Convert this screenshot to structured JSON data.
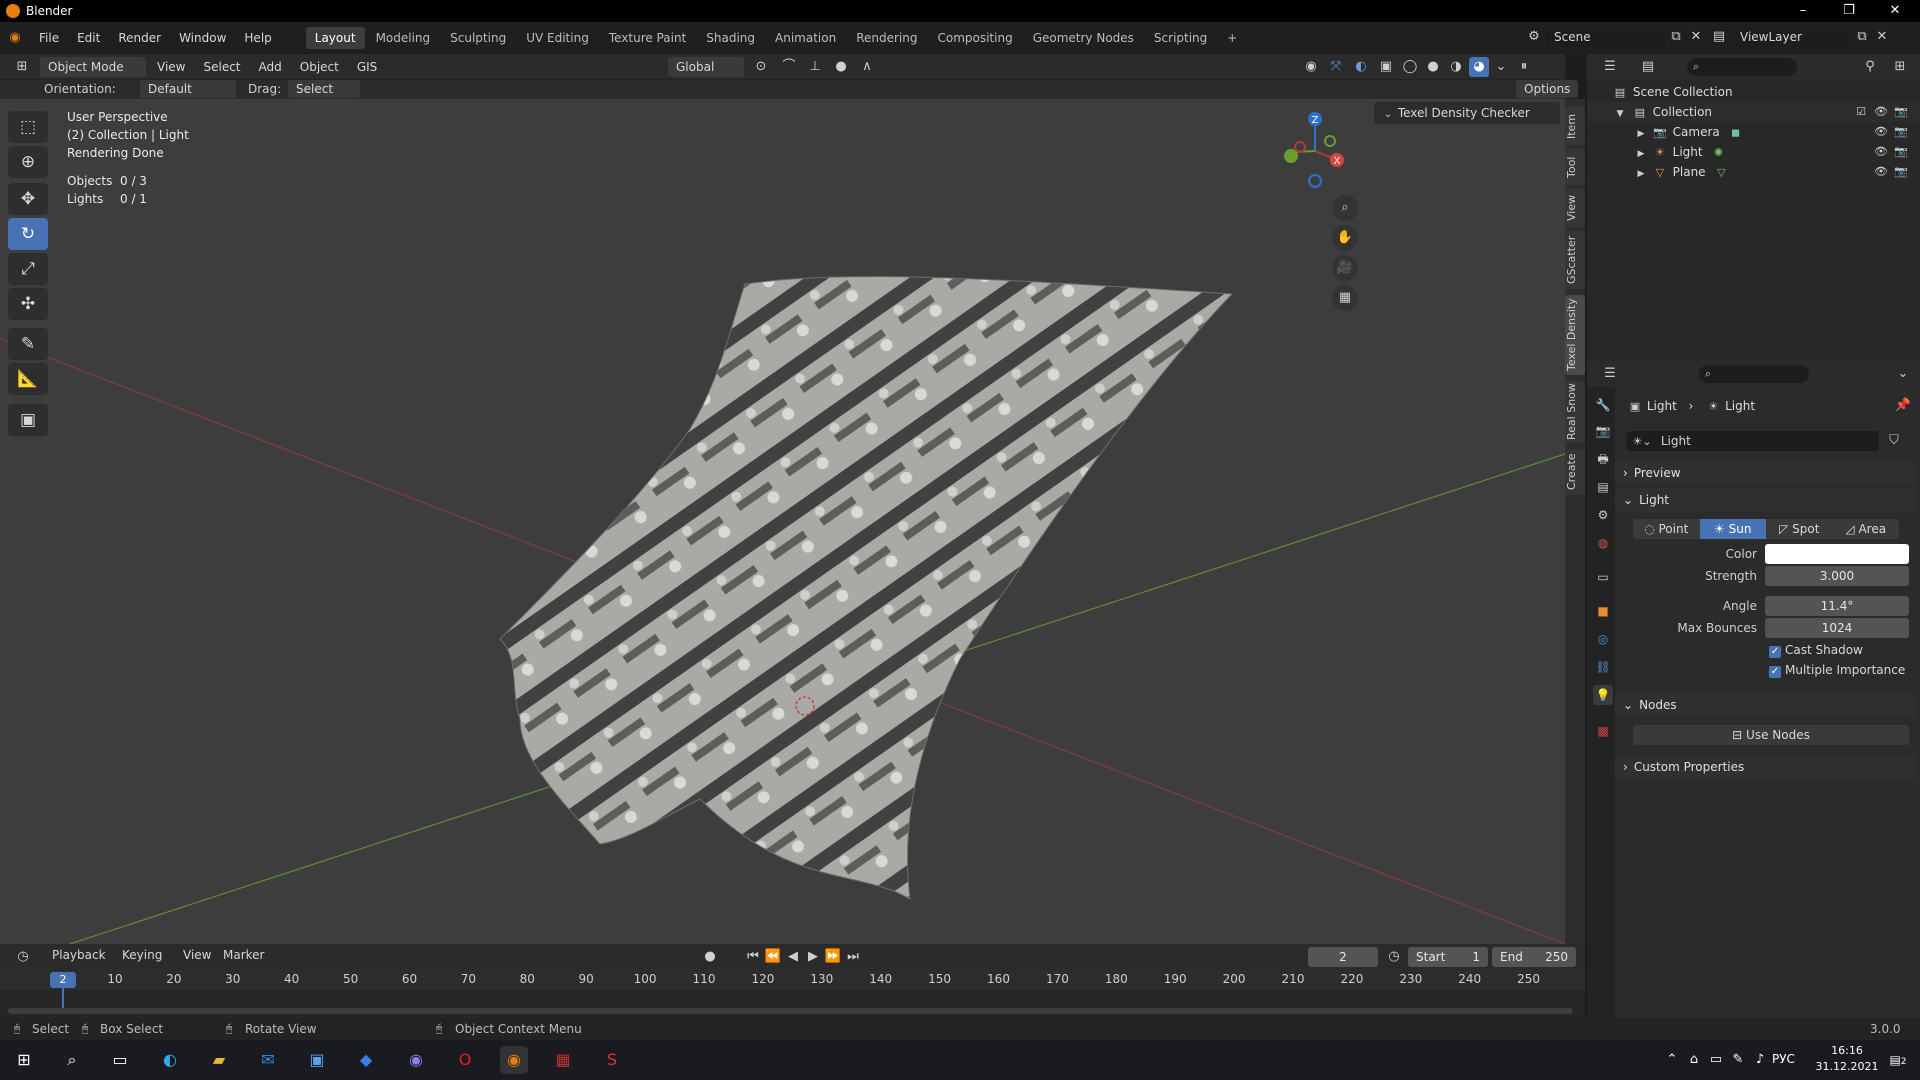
{
  "app": {
    "title": "Blender"
  },
  "menus": [
    "File",
    "Edit",
    "Render",
    "Window",
    "Help"
  ],
  "workspaces": [
    "Layout",
    "Modeling",
    "Sculpting",
    "UV Editing",
    "Texture Paint",
    "Shading",
    "Animation",
    "Rendering",
    "Compositing",
    "Geometry Nodes",
    "Scripting"
  ],
  "workspace_add": "+",
  "scene": {
    "name": "Scene",
    "view_layer": "ViewLayer"
  },
  "viewport_header": {
    "mode": "Object Mode",
    "menus": [
      "View",
      "Select",
      "Add",
      "Object",
      "GIS"
    ],
    "transform_orientation": "Global",
    "orientation_label": "Orientation:",
    "orientation_value": "Default",
    "drag_label": "Drag:",
    "drag_value": "Select Box",
    "options": "Options"
  },
  "viewport_overlay": {
    "view_name": "User Perspective",
    "collection_info": "(2) Collection | Light",
    "render_status": "Rendering Done",
    "stats": [
      {
        "label": "Objects",
        "value": "0 / 3"
      },
      {
        "label": "Lights",
        "value": "0 / 1"
      }
    ]
  },
  "texel_panel": {
    "title": "Texel Density Checker"
  },
  "sidebar_tabs": [
    "Item",
    "Tool",
    "View",
    "GScatter",
    "Texel Density",
    "Real Snow",
    "Create"
  ],
  "gizmo": {
    "z": "Z",
    "x": "X",
    "y": "Y"
  },
  "outliner": {
    "root": "Scene Collection",
    "collection": "Collection",
    "items": [
      {
        "name": "Camera",
        "icon": "camera-icon"
      },
      {
        "name": "Light",
        "icon": "light-icon"
      },
      {
        "name": "Plane",
        "icon": "mesh-icon"
      }
    ]
  },
  "properties": {
    "breadcrumb": [
      "Light",
      "Light"
    ],
    "datablock_name": "Light",
    "panels": {
      "preview": "Preview",
      "light": "Light",
      "nodes": "Nodes",
      "custom": "Custom Properties"
    },
    "light_types": [
      "Point",
      "Sun",
      "Spot",
      "Area"
    ],
    "active_light_type": "Sun",
    "color_label": "Color",
    "color_value": "#ffffff",
    "strength_label": "Strength",
    "strength": "3.000",
    "angle_label": "Angle",
    "angle": "11.4°",
    "max_bounces_label": "Max Bounces",
    "max_bounces": "1024",
    "cast_shadow": "Cast Shadow",
    "multiple_importance": "Multiple Importance",
    "use_nodes": "Use Nodes"
  },
  "timeline": {
    "menus": [
      "Playback",
      "Keying",
      "View",
      "Marker"
    ],
    "current_frame": "2",
    "start_label": "Start",
    "start": "1",
    "end_label": "End",
    "end": "250",
    "ticks": [
      "10",
      "20",
      "30",
      "40",
      "50",
      "60",
      "70",
      "80",
      "90",
      "100",
      "110",
      "120",
      "130",
      "140",
      "150",
      "160",
      "170",
      "180",
      "190",
      "200",
      "210",
      "220",
      "230",
      "240",
      "250"
    ]
  },
  "statusbar": {
    "items": [
      "Select",
      "Box Select",
      "Rotate View",
      "Object Context Menu"
    ],
    "version": "3.0.0"
  },
  "taskbar": {
    "lang": "РУС",
    "time": "16:16",
    "date": "31.12.2021",
    "notifications": "2"
  },
  "colors": {
    "accent": "#4772b3",
    "viewport_bg": "#3d3d3d",
    "x_axis": "#b23a3a",
    "y_axis": "#6b9e2e",
    "z_axis": "#2e6fd0"
  }
}
